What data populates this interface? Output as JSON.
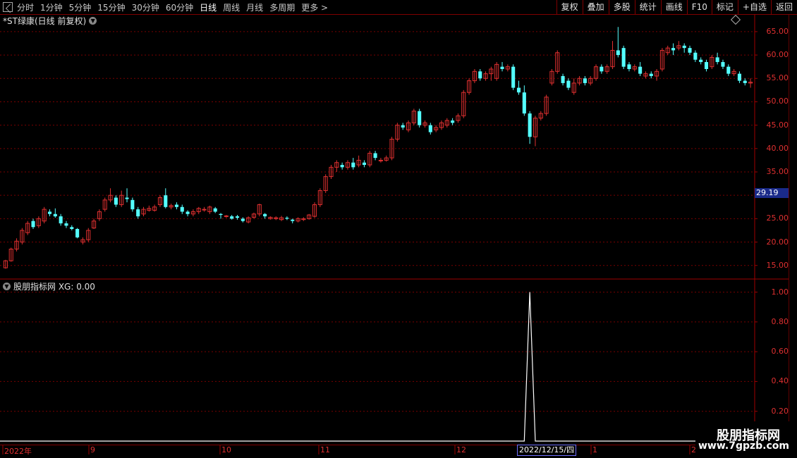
{
  "toolbar": {
    "periods": [
      "分时",
      "1分钟",
      "5分钟",
      "15分钟",
      "30分钟",
      "60分钟",
      "日线",
      "周线",
      "月线",
      "多周期",
      "更多 >"
    ],
    "active_period": "日线",
    "buttons": [
      "复权",
      "叠加",
      "多股",
      "统计",
      "画线",
      "F10",
      "标记",
      "+自选",
      "返回"
    ]
  },
  "main_panel": {
    "title": "*ST绿康(日线 前复权)",
    "y_ticks": [
      "65.00",
      "60.00",
      "55.00",
      "50.00",
      "45.00",
      "40.00",
      "35.00",
      "30.00",
      "25.00",
      "20.00",
      "15.00"
    ],
    "current_price": "29.19"
  },
  "indicator_panel": {
    "title": "股朋指标网 XG: 0.00",
    "y_ticks": [
      "1.00",
      "0.80",
      "0.60",
      "0.40",
      "0.20"
    ]
  },
  "x_axis": {
    "labels": [
      "2022年",
      "9",
      "10",
      "11",
      "12",
      "1",
      "2"
    ],
    "cursor_date": "2022/12/15/四"
  },
  "watermark": {
    "title": "股朋指标网",
    "url": "www.7gpzb.com"
  },
  "colors": {
    "up": "#e03030",
    "down": "#54ffff",
    "grid": "#7a0000",
    "axis_text": "#e03030",
    "indicator_line": "#ffffff"
  },
  "chart_data": {
    "type": "candlestick",
    "y_range": [
      13,
      68
    ],
    "candles": [
      [
        14.5,
        16.0,
        14.3,
        16.2
      ],
      [
        16.0,
        18.5,
        15.8,
        18.8
      ],
      [
        18.5,
        20.2,
        18.0,
        20.8
      ],
      [
        20.0,
        22.5,
        19.5,
        23.0
      ],
      [
        22.0,
        24.0,
        21.5,
        24.5
      ],
      [
        24.5,
        23.2,
        22.8,
        25.0
      ],
      [
        23.5,
        25.0,
        23.0,
        25.5
      ],
      [
        24.5,
        27.0,
        24.0,
        27.5
      ],
      [
        26.5,
        26.0,
        25.5,
        27.0
      ],
      [
        26.0,
        25.5,
        25.2,
        27.2
      ],
      [
        25.5,
        24.0,
        23.5,
        26.0
      ],
      [
        24.0,
        23.5,
        23.0,
        24.5
      ],
      [
        23.2,
        22.8,
        22.5,
        23.6
      ],
      [
        22.8,
        21.0,
        20.8,
        23.0
      ],
      [
        20.0,
        20.5,
        19.5,
        21.0
      ],
      [
        20.5,
        22.5,
        20.0,
        23.0
      ],
      [
        23.0,
        24.5,
        22.8,
        25.0
      ],
      [
        25.0,
        26.5,
        24.5,
        27.0
      ],
      [
        27.0,
        29.0,
        26.5,
        29.5
      ],
      [
        29.0,
        30.0,
        28.5,
        31.5
      ],
      [
        29.5,
        28.0,
        27.5,
        30.0
      ],
      [
        28.0,
        30.0,
        27.5,
        31.0
      ],
      [
        29.5,
        29.2,
        28.5,
        31.5
      ],
      [
        29.0,
        27.0,
        26.5,
        29.5
      ],
      [
        27.0,
        25.5,
        25.0,
        27.5
      ],
      [
        26.0,
        27.0,
        25.5,
        27.5
      ],
      [
        26.8,
        27.2,
        26.5,
        27.8
      ],
      [
        26.8,
        27.5,
        26.5,
        28.0
      ],
      [
        28.0,
        29.5,
        27.5,
        30.0
      ],
      [
        30.0,
        27.5,
        27.2,
        31.5
      ],
      [
        27.5,
        27.8,
        27.0,
        28.2
      ],
      [
        28.0,
        27.5,
        27.0,
        28.5
      ],
      [
        27.5,
        26.5,
        26.0,
        28.0
      ],
      [
        26.5,
        26.0,
        25.5,
        26.8
      ],
      [
        26.0,
        26.5,
        25.5,
        27.0
      ],
      [
        26.5,
        27.2,
        26.0,
        27.5
      ],
      [
        27.0,
        27.0,
        26.5,
        27.5
      ],
      [
        26.5,
        27.5,
        26.0,
        27.8
      ],
      [
        27.2,
        26.5,
        26.2,
        27.5
      ],
      [
        26.0,
        25.8,
        25.0,
        26.2
      ],
      [
        25.5,
        25.6,
        25.2,
        25.8
      ],
      [
        25.5,
        25.0,
        24.8,
        25.8
      ],
      [
        25.5,
        25.2,
        24.8,
        25.8
      ],
      [
        25.0,
        24.5,
        24.2,
        25.3
      ],
      [
        24.3,
        25.2,
        24.0,
        25.5
      ],
      [
        25.3,
        26.0,
        25.0,
        26.3
      ],
      [
        26.0,
        28.0,
        25.5,
        28.2
      ],
      [
        26.0,
        25.5,
        25.0,
        26.2
      ],
      [
        25.0,
        25.3,
        24.8,
        25.5
      ],
      [
        25.0,
        25.2,
        24.7,
        25.5
      ],
      [
        24.8,
        25.2,
        24.5,
        25.6
      ],
      [
        25.2,
        25.0,
        24.7,
        25.5
      ],
      [
        24.8,
        24.5,
        24.0,
        25.0
      ],
      [
        24.5,
        25.0,
        24.2,
        25.3
      ],
      [
        24.8,
        25.0,
        24.5,
        25.3
      ],
      [
        25.0,
        25.8,
        24.8,
        26.0
      ],
      [
        25.5,
        28.0,
        25.2,
        28.5
      ],
      [
        28.0,
        31.0,
        27.5,
        31.5
      ],
      [
        31.0,
        34.0,
        30.5,
        34.5
      ],
      [
        34.0,
        36.0,
        33.5,
        36.5
      ],
      [
        36.0,
        37.0,
        35.0,
        37.5
      ],
      [
        36.5,
        36.0,
        35.5,
        37.0
      ],
      [
        36.0,
        37.0,
        35.5,
        37.5
      ],
      [
        37.0,
        36.0,
        35.5,
        38.0
      ],
      [
        36.5,
        37.5,
        36.0,
        38.5
      ],
      [
        37.0,
        36.5,
        36.0,
        37.5
      ],
      [
        36.5,
        39.0,
        36.0,
        39.5
      ],
      [
        39.0,
        38.0,
        37.5,
        39.5
      ],
      [
        37.5,
        37.5,
        37.0,
        38.0
      ],
      [
        37.5,
        38.0,
        37.2,
        38.5
      ],
      [
        38.0,
        42.0,
        37.5,
        42.5
      ],
      [
        42.0,
        45.0,
        41.5,
        45.5
      ],
      [
        45.0,
        44.5,
        44.0,
        45.5
      ],
      [
        44.0,
        45.5,
        43.5,
        46.0
      ],
      [
        45.5,
        48.0,
        45.0,
        48.5
      ],
      [
        48.0,
        45.0,
        44.5,
        48.5
      ],
      [
        45.0,
        45.5,
        44.5,
        46.0
      ],
      [
        45.0,
        43.5,
        43.0,
        45.5
      ],
      [
        44.0,
        44.5,
        43.5,
        45.0
      ],
      [
        44.5,
        45.5,
        44.0,
        46.0
      ],
      [
        45.0,
        46.0,
        44.5,
        46.5
      ],
      [
        46.0,
        45.5,
        45.0,
        46.5
      ],
      [
        46.0,
        47.0,
        45.5,
        47.5
      ],
      [
        47.0,
        52.0,
        46.5,
        52.5
      ],
      [
        52.0,
        54.5,
        51.5,
        55.0
      ],
      [
        54.5,
        56.5,
        54.0,
        57.0
      ],
      [
        56.5,
        55.0,
        54.5,
        57.0
      ],
      [
        55.0,
        56.0,
        54.5,
        56.5
      ],
      [
        56.0,
        57.0,
        54.5,
        57.5
      ],
      [
        55.0,
        58.0,
        54.5,
        58.5
      ],
      [
        57.5,
        57.0,
        56.5,
        58.5
      ],
      [
        57.0,
        57.5,
        56.5,
        58.0
      ],
      [
        57.5,
        53.0,
        52.5,
        58.0
      ],
      [
        53.0,
        52.0,
        51.5,
        54.5
      ],
      [
        52.0,
        47.5,
        47.0,
        53.5
      ],
      [
        47.5,
        42.5,
        41.0,
        48.0
      ],
      [
        42.5,
        46.5,
        40.5,
        47.0
      ],
      [
        46.5,
        47.5,
        46.0,
        48.0
      ],
      [
        47.5,
        51.0,
        47.0,
        51.5
      ],
      [
        54.0,
        56.5,
        53.5,
        57.0
      ],
      [
        56.5,
        60.5,
        56.0,
        61.0
      ],
      [
        55.5,
        54.0,
        53.5,
        56.0
      ],
      [
        54.5,
        53.0,
        52.5,
        55.0
      ],
      [
        52.0,
        54.0,
        51.5,
        55.0
      ],
      [
        54.0,
        55.0,
        53.5,
        55.5
      ],
      [
        55.0,
        54.0,
        53.5,
        55.5
      ],
      [
        54.0,
        55.0,
        53.5,
        55.5
      ],
      [
        55.0,
        57.5,
        54.5,
        58.0
      ],
      [
        57.5,
        56.5,
        56.0,
        58.0
      ],
      [
        56.5,
        57.5,
        56.0,
        58.0
      ],
      [
        57.5,
        61.0,
        57.0,
        63.0
      ],
      [
        61.0,
        60.0,
        59.5,
        66.0
      ],
      [
        61.5,
        57.5,
        57.0,
        62.0
      ],
      [
        58.0,
        57.0,
        56.5,
        58.5
      ],
      [
        57.0,
        57.5,
        56.5,
        58.0
      ],
      [
        57.5,
        56.0,
        55.5,
        58.5
      ],
      [
        55.5,
        56.0,
        55.0,
        56.5
      ],
      [
        56.0,
        55.5,
        55.0,
        56.5
      ],
      [
        55.5,
        56.5,
        54.5,
        57.0
      ],
      [
        57.0,
        61.0,
        56.5,
        61.5
      ],
      [
        60.5,
        61.5,
        60.0,
        62.0
      ],
      [
        61.5,
        61.0,
        60.0,
        62.5
      ],
      [
        61.5,
        62.0,
        61.0,
        63.0
      ],
      [
        62.0,
        61.5,
        60.5,
        62.5
      ],
      [
        61.5,
        60.5,
        60.0,
        62.0
      ],
      [
        60.5,
        59.0,
        58.5,
        61.0
      ],
      [
        59.0,
        58.5,
        58.0,
        59.5
      ],
      [
        58.5,
        57.0,
        56.5,
        59.0
      ],
      [
        57.5,
        59.5,
        57.0,
        60.0
      ],
      [
        59.5,
        58.5,
        58.0,
        60.5
      ],
      [
        58.5,
        57.5,
        57.0,
        59.0
      ],
      [
        57.5,
        56.0,
        55.5,
        58.0
      ],
      [
        56.0,
        56.5,
        55.5,
        57.0
      ],
      [
        56.0,
        54.5,
        54.0,
        56.5
      ],
      [
        54.5,
        54.0,
        53.5,
        55.0
      ],
      [
        54.0,
        54.2,
        53.0,
        55.0
      ]
    ],
    "indicator": {
      "name": "XG",
      "value": 0.0,
      "y_range": [
        0,
        1.05
      ],
      "spike_index": 95,
      "spike_value": 1.0
    }
  }
}
